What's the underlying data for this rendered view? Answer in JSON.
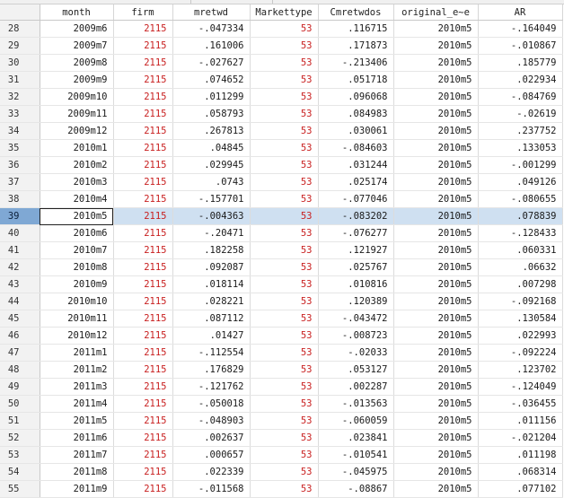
{
  "columns": [
    "",
    "month",
    "firm",
    "mretwd",
    "Markettype",
    "Cmretwdos",
    "original_e~e",
    "AR"
  ],
  "selected_row": "39",
  "rows": [
    [
      "28",
      "2009m6",
      "2115",
      "-.047334",
      "53",
      ".116715",
      "2010m5",
      "-.164049"
    ],
    [
      "29",
      "2009m7",
      "2115",
      ".161006",
      "53",
      ".171873",
      "2010m5",
      "-.010867"
    ],
    [
      "30",
      "2009m8",
      "2115",
      "-.027627",
      "53",
      "-.213406",
      "2010m5",
      ".185779"
    ],
    [
      "31",
      "2009m9",
      "2115",
      ".074652",
      "53",
      ".051718",
      "2010m5",
      ".022934"
    ],
    [
      "32",
      "2009m10",
      "2115",
      ".011299",
      "53",
      ".096068",
      "2010m5",
      "-.084769"
    ],
    [
      "33",
      "2009m11",
      "2115",
      ".058793",
      "53",
      ".084983",
      "2010m5",
      "-.02619"
    ],
    [
      "34",
      "2009m12",
      "2115",
      ".267813",
      "53",
      ".030061",
      "2010m5",
      ".237752"
    ],
    [
      "35",
      "2010m1",
      "2115",
      ".04845",
      "53",
      "-.084603",
      "2010m5",
      ".133053"
    ],
    [
      "36",
      "2010m2",
      "2115",
      ".029945",
      "53",
      ".031244",
      "2010m5",
      "-.001299"
    ],
    [
      "37",
      "2010m3",
      "2115",
      ".0743",
      "53",
      ".025174",
      "2010m5",
      ".049126"
    ],
    [
      "38",
      "2010m4",
      "2115",
      "-.157701",
      "53",
      "-.077046",
      "2010m5",
      "-.080655"
    ],
    [
      "39",
      "2010m5",
      "2115",
      "-.004363",
      "53",
      "-.083202",
      "2010m5",
      ".078839"
    ],
    [
      "40",
      "2010m6",
      "2115",
      "-.20471",
      "53",
      "-.076277",
      "2010m5",
      "-.128433"
    ],
    [
      "41",
      "2010m7",
      "2115",
      ".182258",
      "53",
      ".121927",
      "2010m5",
      ".060331"
    ],
    [
      "42",
      "2010m8",
      "2115",
      ".092087",
      "53",
      ".025767",
      "2010m5",
      ".06632"
    ],
    [
      "43",
      "2010m9",
      "2115",
      ".018114",
      "53",
      ".010816",
      "2010m5",
      ".007298"
    ],
    [
      "44",
      "2010m10",
      "2115",
      ".028221",
      "53",
      ".120389",
      "2010m5",
      "-.092168"
    ],
    [
      "45",
      "2010m11",
      "2115",
      ".087112",
      "53",
      "-.043472",
      "2010m5",
      ".130584"
    ],
    [
      "46",
      "2010m12",
      "2115",
      ".01427",
      "53",
      "-.008723",
      "2010m5",
      ".022993"
    ],
    [
      "47",
      "2011m1",
      "2115",
      "-.112554",
      "53",
      "-.02033",
      "2010m5",
      "-.092224"
    ],
    [
      "48",
      "2011m2",
      "2115",
      ".176829",
      "53",
      ".053127",
      "2010m5",
      ".123702"
    ],
    [
      "49",
      "2011m3",
      "2115",
      "-.121762",
      "53",
      ".002287",
      "2010m5",
      "-.124049"
    ],
    [
      "50",
      "2011m4",
      "2115",
      "-.050018",
      "53",
      "-.013563",
      "2010m5",
      "-.036455"
    ],
    [
      "51",
      "2011m5",
      "2115",
      "-.048903",
      "53",
      "-.060059",
      "2010m5",
      ".011156"
    ],
    [
      "52",
      "2011m6",
      "2115",
      ".002637",
      "53",
      ".023841",
      "2010m5",
      "-.021204"
    ],
    [
      "53",
      "2011m7",
      "2115",
      ".000657",
      "53",
      "-.010541",
      "2010m5",
      ".011198"
    ],
    [
      "54",
      "2011m8",
      "2115",
      ".022339",
      "53",
      "-.045975",
      "2010m5",
      ".068314"
    ],
    [
      "55",
      "2011m9",
      "2115",
      "-.011568",
      "53",
      "-.08867",
      "2010m5",
      ".077102"
    ]
  ]
}
